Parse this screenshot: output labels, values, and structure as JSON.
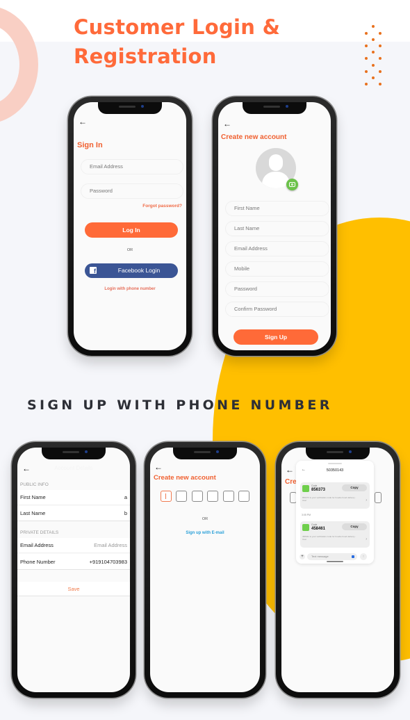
{
  "hero": {
    "title_line1": "Customer Login &",
    "title_line2": "Registration"
  },
  "section": {
    "title": "SIGN UP WITH PHONE NUMBER"
  },
  "colors": {
    "accent": "#ff6a3a",
    "yellow": "#ffbf00",
    "facebook": "#3b5595",
    "link_blue": "#2aa0d8",
    "camera_green": "#6cc24a"
  },
  "signin_screen": {
    "title": "Sign In",
    "email_placeholder": "Email Address",
    "password_placeholder": "Password",
    "forgot_password": "Forgot password?",
    "login_button": "Log In",
    "or_label": "OR",
    "facebook_button": "Facebook Login",
    "facebook_icon_glyph": "f",
    "phone_login_link": "Login with phone number"
  },
  "register_screen": {
    "title": "Create new account",
    "fields": [
      "First Name",
      "Last Name",
      "Email Address",
      "Mobile",
      "Password",
      "Confirm Password"
    ],
    "signup_button": "Sign Up"
  },
  "account_screen": {
    "title": "Account Details",
    "public_section": "PUBLIC INFO",
    "private_section": "PRIVATE DETAILS",
    "rows": [
      {
        "label": "First Name",
        "value": "a"
      },
      {
        "label": "Last Name",
        "value": "b"
      },
      {
        "label": "Email Address",
        "value": "Email Address"
      },
      {
        "label": "Phone Number",
        "value": "+919104703983"
      }
    ],
    "save_button": "Save"
  },
  "otp_screen": {
    "title": "Create new account",
    "otp_digits": [
      "",
      "",
      "",
      "",
      "",
      ""
    ],
    "or_label": "OR",
    "email_signup_link": "Sign up with E-mail"
  },
  "sms_screen": {
    "bg_title": "Crea",
    "sender": "50350143",
    "messages": [
      {
        "code_label": "Code",
        "code": "856373",
        "copy": "Copy",
        "body": "856373 is your verification code for Foodie Food delivery - User"
      },
      {
        "code_label": "Code",
        "code": "458461",
        "copy": "Copy",
        "body": "458461 is your verification code for Foodie Food delivery - User"
      }
    ],
    "timestamp": "3:05 PM",
    "input_placeholder": "Text message"
  }
}
